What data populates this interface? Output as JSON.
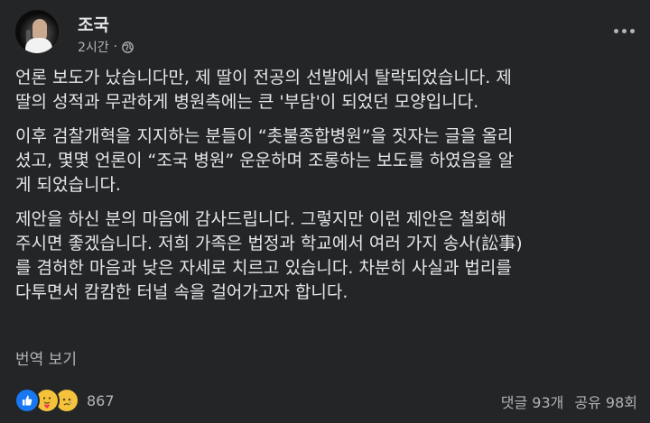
{
  "post": {
    "author": "조국",
    "time": "2시간",
    "paragraphs": [
      [
        "언론 보도가 났습니다만, 제 딸이 전공의 선발에서 탈락되었습니다. 제",
        "딸의 성적과 무관하게 병원측에는 큰 '부담'이 되었던 모양입니다."
      ],
      [
        "이후 검찰개혁을 지지하는 분들이  “촛불종합병원”을 짓자는 글을 올리",
        "셨고, 몇몇 언론이 “조국 병원” 운운하며 조롱하는 보도를 하였음을 알",
        "게 되었습니다."
      ],
      [
        "제안을 하신 분의 마음에 감사드립니다. 그렇지만 이런 제안은 철회해",
        "주시면 좋겠습니다. 저희 가족은 법정과 학교에서 여러 가지 송사(訟事)",
        "를 겸허한 마음과 낮은 자세로 치르고 있습니다. 차분히 사실과 법리를",
        "다투면서 캄캄한 터널 속을 걸어가고자 합니다."
      ]
    ],
    "translate_label": "번역 보기"
  },
  "footer": {
    "reaction_icons": [
      "like-icon",
      "care-icon",
      "sad-icon"
    ],
    "reaction_count": "867",
    "comments": "댓글 93개",
    "shares": "공유 98회"
  }
}
